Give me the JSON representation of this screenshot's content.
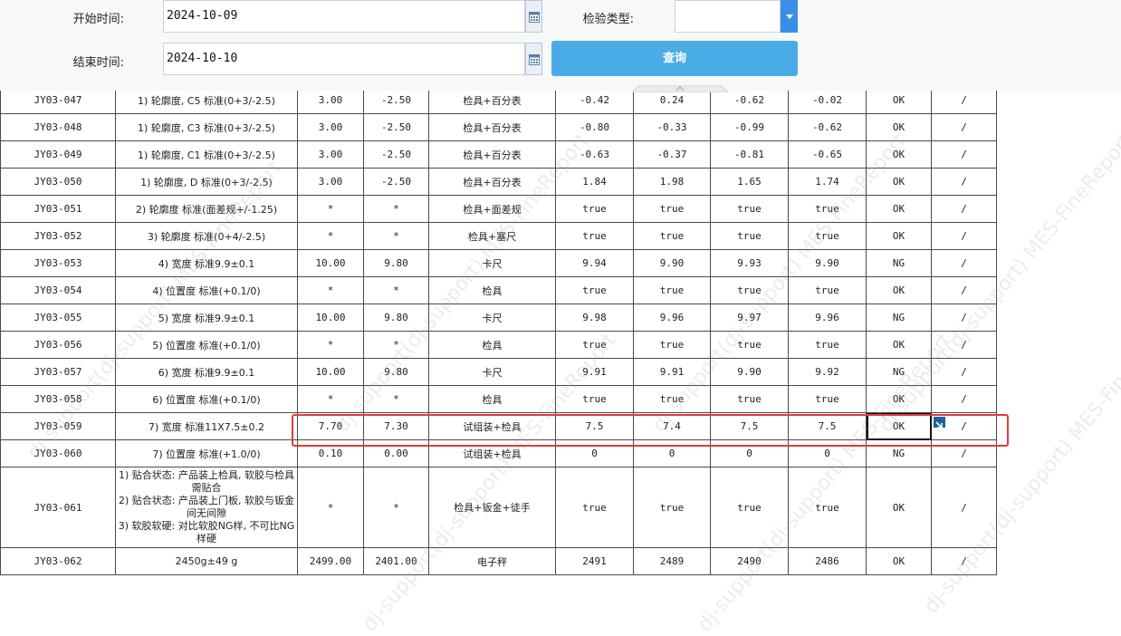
{
  "filters": {
    "start_label": "开始时间:",
    "start_value": "2024-10-09",
    "end_label": "结束时间:",
    "end_value": "2024-10-10",
    "type_label": "检验类型:",
    "type_value": "",
    "query_label": "查询"
  },
  "watermark_text": "dj-support(dj-support) MES-FineReport",
  "table": {
    "rows": [
      {
        "code": "JY03-047",
        "desc": "1) 轮廓度, C5 标准(0+3/-2.5)",
        "upper": "3.00",
        "lower": "-2.50",
        "tool": "检具+百分表",
        "m1": "-0.42",
        "m2": "0.24",
        "m3": "-0.62",
        "m4": "-0.02",
        "result": "OK",
        "remark": "/"
      },
      {
        "code": "JY03-048",
        "desc": "1) 轮廓度, C3 标准(0+3/-2.5)",
        "upper": "3.00",
        "lower": "-2.50",
        "tool": "检具+百分表",
        "m1": "-0.80",
        "m2": "-0.33",
        "m3": "-0.99",
        "m4": "-0.62",
        "result": "OK",
        "remark": "/"
      },
      {
        "code": "JY03-049",
        "desc": "1) 轮廓度, C1 标准(0+3/-2.5)",
        "upper": "3.00",
        "lower": "-2.50",
        "tool": "检具+百分表",
        "m1": "-0.63",
        "m2": "-0.37",
        "m3": "-0.81",
        "m4": "-0.65",
        "result": "OK",
        "remark": "/"
      },
      {
        "code": "JY03-050",
        "desc": "1) 轮廓度, D 标准(0+3/-2.5)",
        "upper": "3.00",
        "lower": "-2.50",
        "tool": "检具+百分表",
        "m1": "1.84",
        "m2": "1.98",
        "m3": "1.65",
        "m4": "1.74",
        "result": "OK",
        "remark": "/"
      },
      {
        "code": "JY03-051",
        "desc": "2) 轮廓度 标准(面差规+/-1.25)",
        "upper": "*",
        "lower": "*",
        "tool": "检具+面差规",
        "m1": "true",
        "m2": "true",
        "m3": "true",
        "m4": "true",
        "result": "OK",
        "remark": "/"
      },
      {
        "code": "JY03-052",
        "desc": "3) 轮廓度 标准(0+4/-2.5)",
        "upper": "*",
        "lower": "*",
        "tool": "检具+塞尺",
        "m1": "true",
        "m2": "true",
        "m3": "true",
        "m4": "true",
        "result": "OK",
        "remark": "/"
      },
      {
        "code": "JY03-053",
        "desc": "4) 宽度 标准9.9±0.1",
        "upper": "10.00",
        "lower": "9.80",
        "tool": "卡尺",
        "m1": "9.94",
        "m2": "9.90",
        "m3": "9.93",
        "m4": "9.90",
        "result": "NG",
        "remark": "/"
      },
      {
        "code": "JY03-054",
        "desc": "4) 位置度 标准(+0.1/0)",
        "upper": "*",
        "lower": "*",
        "tool": "检具",
        "m1": "true",
        "m2": "true",
        "m3": "true",
        "m4": "true",
        "result": "OK",
        "remark": "/"
      },
      {
        "code": "JY03-055",
        "desc": "5) 宽度 标准9.9±0.1",
        "upper": "10.00",
        "lower": "9.80",
        "tool": "卡尺",
        "m1": "9.98",
        "m2": "9.96",
        "m3": "9.97",
        "m4": "9.96",
        "result": "NG",
        "remark": "/"
      },
      {
        "code": "JY03-056",
        "desc": "5) 位置度 标准(+0.1/0)",
        "upper": "*",
        "lower": "*",
        "tool": "检具",
        "m1": "true",
        "m2": "true",
        "m3": "true",
        "m4": "true",
        "result": "OK",
        "remark": "/"
      },
      {
        "code": "JY03-057",
        "desc": "6) 宽度 标准9.9±0.1",
        "upper": "10.00",
        "lower": "9.80",
        "tool": "卡尺",
        "m1": "9.91",
        "m2": "9.91",
        "m3": "9.90",
        "m4": "9.92",
        "result": "NG",
        "remark": "/"
      },
      {
        "code": "JY03-058",
        "desc": "6) 位置度 标准(+0.1/0)",
        "upper": "*",
        "lower": "*",
        "tool": "检具",
        "m1": "true",
        "m2": "true",
        "m3": "true",
        "m4": "true",
        "result": "OK",
        "remark": "/"
      },
      {
        "code": "JY03-059",
        "desc": "7) 宽度 标准11X7.5±0.2",
        "upper": "7.70",
        "lower": "7.30",
        "tool": "试组装+检具",
        "m1": "7.5",
        "m2": "7.4",
        "m3": "7.5",
        "m4": "7.5",
        "result": "OK",
        "remark": "/"
      },
      {
        "code": "JY03-060",
        "desc": "7) 位置度 标准(+1.0/0)",
        "upper": "0.10",
        "lower": "0.00",
        "tool": "试组装+检具",
        "m1": "0",
        "m2": "0",
        "m3": "0",
        "m4": "0",
        "result": "NG",
        "remark": "/"
      },
      {
        "code": "JY03-061",
        "desc": "1) 贴合状态: 产品装上检具, 软胶与检具需贴合\n2) 贴合状态: 产品装上门板, 软胶与钣金间无间隙\n3) 软胶软硬: 对比软胶NG样, 不可比NG样硬",
        "upper": "*",
        "lower": "*",
        "tool": "检具+钣金+徒手",
        "m1": "true",
        "m2": "true",
        "m3": "true",
        "m4": "true",
        "result": "OK",
        "remark": "/"
      },
      {
        "code": "JY03-062",
        "desc": "2450g±49 g",
        "upper": "2499.00",
        "lower": "2401.00",
        "tool": "电子秤",
        "m1": "2491",
        "m2": "2489",
        "m3": "2490",
        "m4": "2486",
        "result": "OK",
        "remark": "/"
      }
    ]
  }
}
